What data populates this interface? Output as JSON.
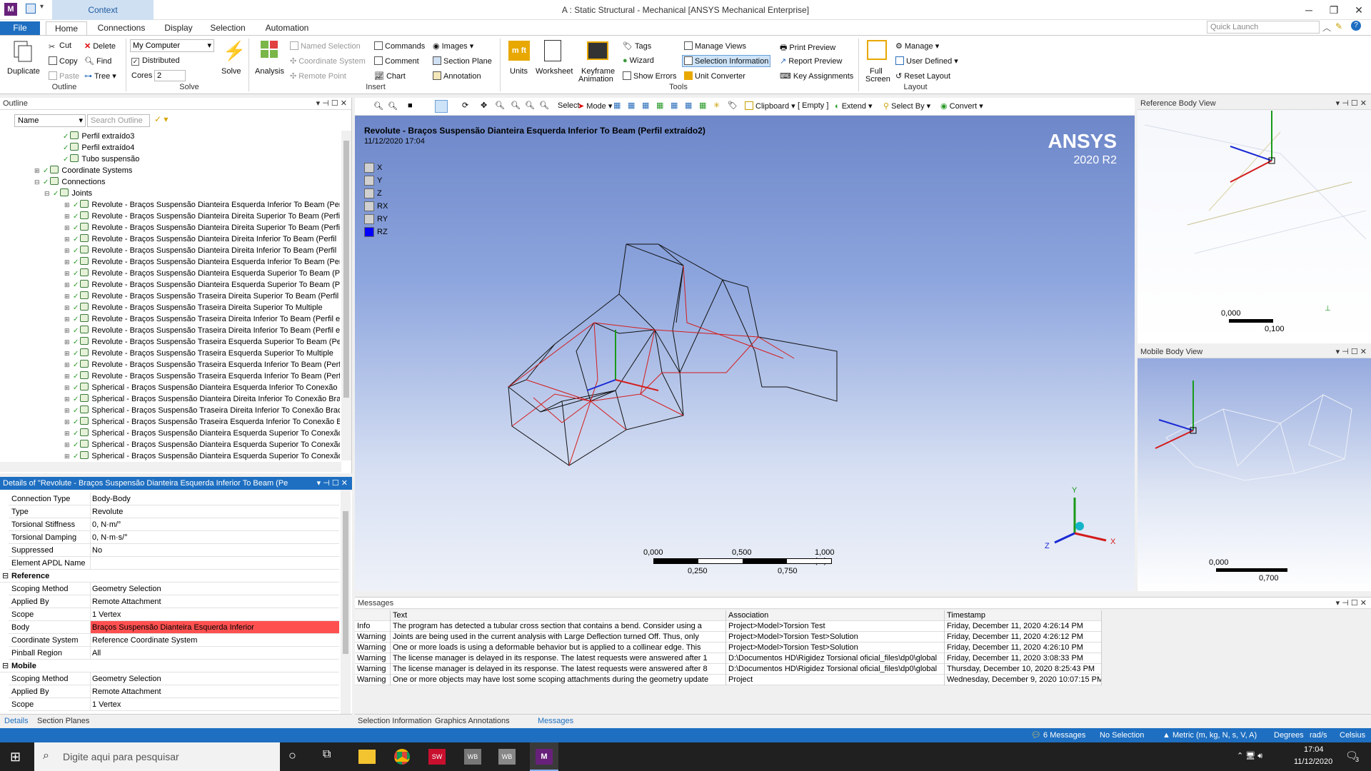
{
  "window": {
    "title": "A : Static Structural - Mechanical [ANSYS Mechanical Enterprise]",
    "context_tab": "Context",
    "app_icon": "M"
  },
  "ribbon_tabs": [
    "File",
    "Home",
    "Connections",
    "Display",
    "Selection",
    "Automation"
  ],
  "quick_launch": {
    "placeholder": "Quick Launch"
  },
  "ribbon": {
    "duplicate": "Duplicate",
    "cut": "Cut",
    "copy": "Copy",
    "paste": "Paste",
    "delete": "Delete",
    "find": "Find",
    "tree": "Tree",
    "outline_group": "Outline",
    "computer": "My Computer",
    "distributed": "Distributed",
    "cores_label": "Cores",
    "cores_value": "2",
    "solve": "Solve",
    "solve_group": "Solve",
    "analysis": "Analysis",
    "named_selection": "Named Selection",
    "coordinate_system": "Coordinate System",
    "remote_point": "Remote Point",
    "commands": "Commands",
    "comment": "Comment",
    "chart": "Chart",
    "images": "Images",
    "section_plane": "Section Plane",
    "annotation": "Annotation",
    "insert_group": "Insert",
    "units": "Units",
    "worksheet": "Worksheet",
    "keyframe1": "Keyframe",
    "keyframe2": "Animation",
    "tags": "Tags",
    "wizard": "Wizard",
    "show_errors": "Show Errors",
    "manage_views": "Manage Views",
    "selection_information": "Selection Information",
    "unit_converter": "Unit Converter",
    "print_preview": "Print Preview",
    "report_preview": "Report Preview",
    "key_assignments": "Key Assignments",
    "tools_group": "Tools",
    "full1": "Full",
    "full2": "Screen",
    "manage": "Manage",
    "user_defined": "User Defined",
    "reset_layout": "Reset Layout",
    "layout_group": "Layout"
  },
  "outline": {
    "title": "Outline",
    "name_filter": "Name",
    "search_placeholder": "Search Outline",
    "items": [
      {
        "indent": 5,
        "label": "Perfil extraído3"
      },
      {
        "indent": 5,
        "label": "Perfil extraído4"
      },
      {
        "indent": 5,
        "label": "Tubo suspensão"
      },
      {
        "indent": 3,
        "label": "Coordinate Systems"
      },
      {
        "indent": 3,
        "label": "Connections"
      },
      {
        "indent": 4,
        "label": "Joints"
      },
      {
        "indent": 6,
        "label": "Revolute - Braços Suspensão Dianteira Esquerda Inferior To Beam (Per"
      },
      {
        "indent": 6,
        "label": "Revolute - Braços Suspensão Dianteira Direita Superior To Beam (Perfil"
      },
      {
        "indent": 6,
        "label": "Revolute - Braços Suspensão Dianteira Direita Superior To Beam (Perfil"
      },
      {
        "indent": 6,
        "label": "Revolute - Braços Suspensão Dianteira Direita Inferior To Beam (Perfil"
      },
      {
        "indent": 6,
        "label": "Revolute - Braços Suspensão Dianteira Direita Inferior To Beam (Perfil"
      },
      {
        "indent": 6,
        "label": "Revolute - Braços Suspensão Dianteira Esquerda Inferior To Beam (Per"
      },
      {
        "indent": 6,
        "label": "Revolute - Braços Suspensão Dianteira Esquerda Superior To Beam (Pe"
      },
      {
        "indent": 6,
        "label": "Revolute - Braços Suspensão Dianteira Esquerda Superior To Beam (Pe"
      },
      {
        "indent": 6,
        "label": "Revolute - Braços Suspensão Traseira Direita Superior To Beam (Perfil"
      },
      {
        "indent": 6,
        "label": "Revolute - Braços Suspensão Traseira Direita Superior To Multiple"
      },
      {
        "indent": 6,
        "label": "Revolute - Braços Suspensão Traseira Direita Inferior To Beam (Perfil e"
      },
      {
        "indent": 6,
        "label": "Revolute - Braços Suspensão Traseira Direita Inferior To Beam (Perfil e"
      },
      {
        "indent": 6,
        "label": "Revolute - Braços Suspensão Traseira Esquerda Superior To Beam (Per"
      },
      {
        "indent": 6,
        "label": "Revolute - Braços Suspensão Traseira Esquerda Superior To Multiple"
      },
      {
        "indent": 6,
        "label": "Revolute - Braços Suspensão Traseira Esquerda Inferior To Beam (Perf"
      },
      {
        "indent": 6,
        "label": "Revolute - Braços Suspensão Traseira Esquerda Inferior To Beam (Perf"
      },
      {
        "indent": 6,
        "label": "Spherical - Braços Suspensão Dianteira Esquerda Inferior To Conexão I"
      },
      {
        "indent": 6,
        "label": "Spherical - Braços Suspensão Dianteira Direita Inferior To Conexão Bra"
      },
      {
        "indent": 6,
        "label": "Spherical - Braços Suspensão Traseira Direita Inferior To Conexão Brac"
      },
      {
        "indent": 6,
        "label": "Spherical - Braços Suspensão Traseira Esquerda Inferior To Conexão B"
      },
      {
        "indent": 6,
        "label": "Spherical - Braços Suspensão Dianteira Esquerda Superior To Conexão"
      },
      {
        "indent": 6,
        "label": "Spherical - Braços Suspensão Dianteira Esquerda Superior To Conexão"
      },
      {
        "indent": 6,
        "label": "Spherical - Braços Suspensão Dianteira Esquerda Superior To Conexão"
      }
    ]
  },
  "details": {
    "title": "Details of \"Revolute - Braços Suspensão Dianteira Esquerda Inferior To Beam (Pe",
    "rows": [
      {
        "type": "row",
        "key": "Connection Type",
        "value": "Body-Body"
      },
      {
        "type": "row",
        "key": "Type",
        "value": "Revolute"
      },
      {
        "type": "row",
        "key": "Torsional Stiffness",
        "value": "0, N·m/°"
      },
      {
        "type": "row",
        "key": "Torsional Damping",
        "value": "0, N·m·s/°"
      },
      {
        "type": "row",
        "key": "Suppressed",
        "value": "No"
      },
      {
        "type": "row",
        "key": "Element APDL Name",
        "value": ""
      },
      {
        "type": "section",
        "key": "Reference"
      },
      {
        "type": "row",
        "key": "Scoping Method",
        "value": "Geometry Selection"
      },
      {
        "type": "row",
        "key": "Applied By",
        "value": "Remote Attachment"
      },
      {
        "type": "row",
        "key": "Scope",
        "value": "1 Vertex"
      },
      {
        "type": "row",
        "key": "Body",
        "value": "Braços Suspensão Dianteira Esquerda Inferior",
        "highlight": "#ff5050"
      },
      {
        "type": "row",
        "key": "Coordinate System",
        "value": "Reference Coordinate System"
      },
      {
        "type": "row",
        "key": "Pinball Region",
        "value": "All"
      },
      {
        "type": "section",
        "key": "Mobile"
      },
      {
        "type": "row",
        "key": "Scoping Method",
        "value": "Geometry Selection"
      },
      {
        "type": "row",
        "key": "Applied By",
        "value": "Remote Attachment"
      },
      {
        "type": "row",
        "key": "Scope",
        "value": "1 Vertex"
      }
    ]
  },
  "panel_tabs": {
    "details": "Details",
    "section_planes": "Section Planes"
  },
  "toolbar": {
    "select": "Select",
    "mode": "Mode",
    "clipboard": "Clipboard",
    "empty": "[ Empty ]",
    "extend": "Extend",
    "select_by": "Select By",
    "convert": "Convert"
  },
  "viewport": {
    "title": "Revolute - Braços Suspensão Dianteira Esquerda Inferior To Beam (Perfil extraído2)",
    "timestamp": "11/12/2020 17:04",
    "brand": "ANSYS",
    "version": "2020 R2",
    "dofs": [
      {
        "label": "X",
        "color": "#d0d0d0"
      },
      {
        "label": "Y",
        "color": "#d0d0d0"
      },
      {
        "label": "Z",
        "color": "#d0d0d0"
      },
      {
        "label": "RX",
        "color": "#d0d0d0"
      },
      {
        "label": "RY",
        "color": "#d0d0d0"
      },
      {
        "label": "RZ",
        "color": "#0000ff"
      }
    ],
    "scale": {
      "t0": "0,000",
      "t1": "0,500",
      "t2": "1,000 (m)",
      "t3": "0,250",
      "t4": "0,750"
    }
  },
  "reference_view": {
    "title": "Reference Body View",
    "s0": "0,000",
    "s1": "0,100"
  },
  "mobile_view": {
    "title": "Mobile Body View",
    "s0": "0,000",
    "s1": "0,700"
  },
  "messages": {
    "title": "Messages",
    "columns": [
      "",
      "Text",
      "Association",
      "Timestamp"
    ],
    "rows": [
      [
        "Info",
        "The program has detected a tubular cross section that contains a bend. Consider using a",
        "Project>Model>Torsion Test",
        "Friday, December 11, 2020 4:26:14 PM"
      ],
      [
        "Warning",
        "Joints are being used in the current analysis with Large Deflection turned Off.  Thus, only",
        "Project>Model>Torsion Test>Solution",
        "Friday, December 11, 2020 4:26:12 PM"
      ],
      [
        "Warning",
        "One or more loads is using a deformable behavior but is applied to a collinear edge.  This",
        "Project>Model>Torsion Test>Solution",
        "Friday, December 11, 2020 4:26:10 PM"
      ],
      [
        "Warning",
        "The license manager is delayed in its response. The latest requests were answered after 1",
        "D:\\Documentos HD\\Rigidez Torsional oficial_files\\dp0\\global",
        "Friday, December 11, 2020 3:08:33 PM"
      ],
      [
        "Warning",
        "The license manager is delayed in its response. The latest requests were answered after 8",
        "D:\\Documentos HD\\Rigidez Torsional oficial_files\\dp0\\global",
        "Thursday, December 10, 2020 8:25:43 PM"
      ],
      [
        "Warning",
        "One or more objects may have lost some scoping attachments during the geometry update",
        "Project",
        "Wednesday, December 9, 2020 10:07:15 PM"
      ]
    ]
  },
  "bottom_tabs": [
    "Selection Information",
    "Graphics Annotations",
    "Messages"
  ],
  "status": {
    "messages": "6 Messages",
    "selection": "No Selection",
    "units": "Metric (m, kg, N, s, V, A)",
    "degrees": "Degrees",
    "rads": "rad/s",
    "celsius": "Celsius"
  },
  "taskbar": {
    "search_placeholder": "Digite aqui para pesquisar",
    "time": "17:04",
    "date": "11/12/2020",
    "notif": "3"
  }
}
